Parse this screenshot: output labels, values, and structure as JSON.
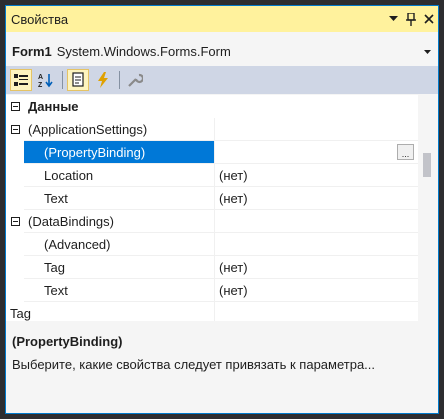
{
  "window": {
    "title": "Свойства"
  },
  "titlebar_icons": [
    "chevron-down-icon",
    "pin-icon",
    "close-icon"
  ],
  "object_selector": {
    "name": "Form1",
    "type": "System.Windows.Forms.Form"
  },
  "toolbar": {
    "buttons": [
      "categorized-icon",
      "alphabetical-icon",
      "properties-icon",
      "events-icon",
      "property-pages-icon"
    ]
  },
  "grid": {
    "rows": [
      {
        "kind": "category",
        "name": "Данные",
        "value": ""
      },
      {
        "kind": "group",
        "name": "(ApplicationSettings)",
        "value": ""
      },
      {
        "kind": "sub",
        "name": "(PropertyBinding)",
        "value": "",
        "selected": true,
        "button": "..."
      },
      {
        "kind": "sub",
        "name": "Location",
        "value": "(нет)"
      },
      {
        "kind": "sub",
        "name": "Text",
        "value": "(нет)"
      },
      {
        "kind": "group",
        "name": "(DataBindings)",
        "value": ""
      },
      {
        "kind": "sub",
        "name": "(Advanced)",
        "value": ""
      },
      {
        "kind": "sub",
        "name": "Tag",
        "value": "(нет)"
      },
      {
        "kind": "sub",
        "name": "Text",
        "value": "(нет)"
      },
      {
        "kind": "plain",
        "name": "Tag",
        "value": ""
      }
    ]
  },
  "description": {
    "name": "(PropertyBinding)",
    "text": "Выберите, какие свойства следует привязать к параметра..."
  },
  "colors": {
    "titlebar": "#fff29d",
    "selection": "#0078d7",
    "toolbar": "#cfd6e5",
    "border": "#007acc"
  }
}
